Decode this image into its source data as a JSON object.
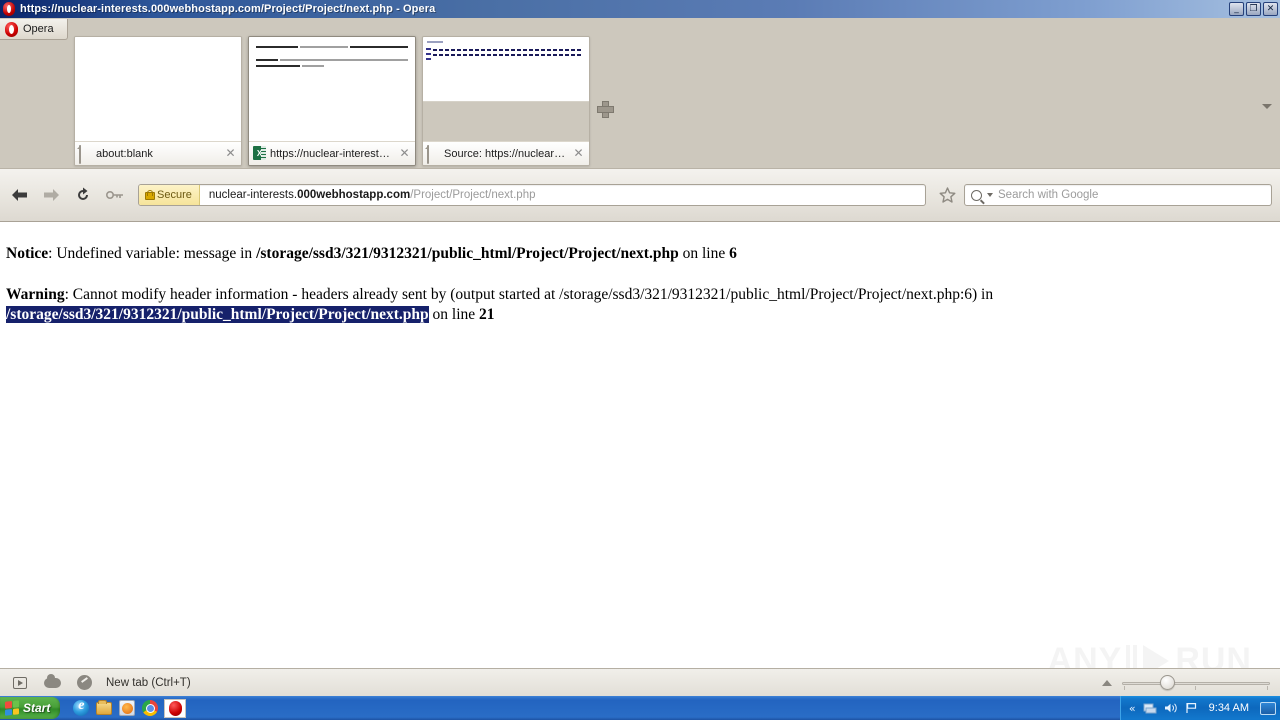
{
  "window": {
    "title": "https://nuclear-interests.000webhostapp.com/Project/Project/next.php - Opera",
    "minimize_label": "_",
    "restore_label": "❐",
    "close_label": "✕"
  },
  "opera_menu": {
    "label": "Opera"
  },
  "tabs": [
    {
      "title": "about:blank",
      "favicon": "page-icon",
      "close_label": "✕",
      "active": false,
      "thumb_kind": "blank"
    },
    {
      "title": "https://nuclear-interest…",
      "favicon": "spreadsheet-icon",
      "close_label": "✕",
      "active": true,
      "thumb_kind": "php-error"
    },
    {
      "title": "Source: https://nuclear-…",
      "favicon": "page-icon",
      "close_label": "✕",
      "active": false,
      "thumb_kind": "source"
    }
  ],
  "new_tab_button": {
    "icon": "plus-icon"
  },
  "tabbar_overflow": {
    "icon": "chevron-down-icon"
  },
  "toolbar": {
    "back_icon": "arrow-left-icon",
    "forward_icon": "arrow-right-icon",
    "reload_icon": "reload-icon",
    "key_icon": "key-icon",
    "security_badge": "Secure",
    "lock_icon": "lock-icon",
    "url_prefix": "nuclear-interests.",
    "url_host_bold": "000webhostapp.com",
    "url_path": "/Project/Project/next.php",
    "bookmark_icon": "star-icon",
    "search_icon": "search-icon",
    "search_dropdown_icon": "chevron-down-icon",
    "search_placeholder": "Search with Google"
  },
  "page": {
    "notice": {
      "label": "Notice",
      "message": ": Undefined variable: message in ",
      "file": "/storage/ssd3/321/9312321/public_html/Project/Project/next.php",
      "on_line": " on line ",
      "line_number": "6"
    },
    "warning": {
      "label": "Warning",
      "message": ": Cannot modify header information - headers already sent by (output started at /storage/ssd3/321/9312321/public_html/Project/Project/next.php:6) in ",
      "selected_file_part1": "/storage/ssd3/321/9312321/public_html/",
      "selected_file_part2": "Project/Project/next.php",
      "on_line": " on line ",
      "line_number": "21"
    },
    "selection_color": "#16216b"
  },
  "watermark": {
    "left_text": "ANY",
    "right_text": "RUN"
  },
  "statusbar": {
    "player_icon": "player-icon",
    "cloud_icon": "cloud-icon",
    "speeddial_icon": "speed-dial-icon",
    "hint": "New tab (Ctrl+T)",
    "zoom_caret_icon": "caret-up-icon"
  },
  "taskbar": {
    "start_label": "Start",
    "quicklaunch": [
      {
        "name": "internet-explorer-icon"
      },
      {
        "name": "file-explorer-icon"
      },
      {
        "name": "media-player-icon"
      },
      {
        "name": "chrome-icon"
      },
      {
        "name": "opera-icon"
      }
    ],
    "tray": {
      "chevron": "«",
      "network_icon": "network-icon",
      "volume_icon": "volume-icon",
      "flag_icon": "flag-icon",
      "clock": "9:34 AM",
      "desktop_icon": "show-desktop-icon"
    }
  }
}
